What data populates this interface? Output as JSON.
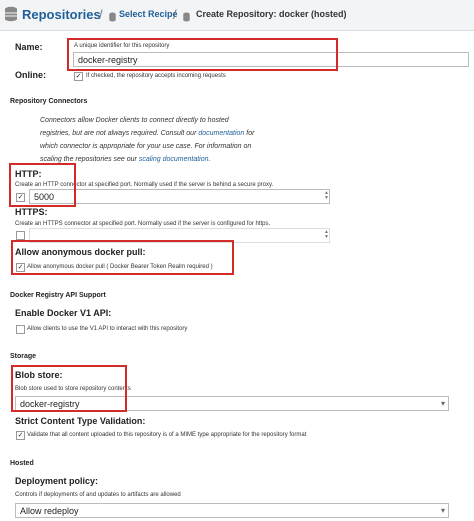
{
  "breadcrumb": {
    "title": "Repositories",
    "sep": "/",
    "link": "Select Recipe",
    "current": "Create Repository: docker (hosted)"
  },
  "name": {
    "label": "Name:",
    "help": "A unique identifier for this repository",
    "value": "docker-registry"
  },
  "online": {
    "label": "Online:",
    "help": "If checked, the repository accepts incoming requests"
  },
  "connectors": {
    "section": "Repository Connectors",
    "info_1": "Connectors allow Docker clients to connect directly to hosted",
    "info_2": "registries, but are not always required. Consult our",
    "info_link_1": "documentation",
    "info_3": "for",
    "info_4": "which connector is appropriate for your use case. For information on",
    "info_5": "scaling the repositories see our",
    "info_link_2": "scaling documentation",
    "info_6": "."
  },
  "http": {
    "label": "HTTP:",
    "help": "Create an HTTP connector at specified port. Normally used if the server is behind a secure proxy.",
    "value": "5000"
  },
  "https": {
    "label": "HTTPS:",
    "help": "Create an HTTPS connector at specified port. Normally used if the server is configured for https.",
    "value": ""
  },
  "anon": {
    "label": "Allow anonymous docker pull:",
    "help": "Allow anonymous docker pull ( Docker Bearer Token Realm required )"
  },
  "api": {
    "section": "Docker Registry API Support",
    "label": "Enable Docker V1 API:",
    "help": "Allow clients to use the V1 API to interact with this repository"
  },
  "storage": {
    "section": "Storage",
    "blob_label": "Blob store:",
    "blob_help": "Blob store used to store repository contents",
    "blob_value": "docker-registry",
    "strict_label": "Strict Content Type Validation:",
    "strict_help": "Validate that all content uploaded to this repository is of a MIME type appropriate for the repository format"
  },
  "hosted": {
    "section": "Hosted",
    "deploy_label": "Deployment policy:",
    "deploy_help": "Controls if deployments of and updates to artifacts are allowed",
    "deploy_value": "Allow redeploy"
  },
  "icons": {
    "repositories": "database-stack-icon",
    "select_recipe": "database-icon",
    "create": "database-icon"
  },
  "colors": {
    "accent": "#1f5f99",
    "highlight": "#d32a2a"
  }
}
